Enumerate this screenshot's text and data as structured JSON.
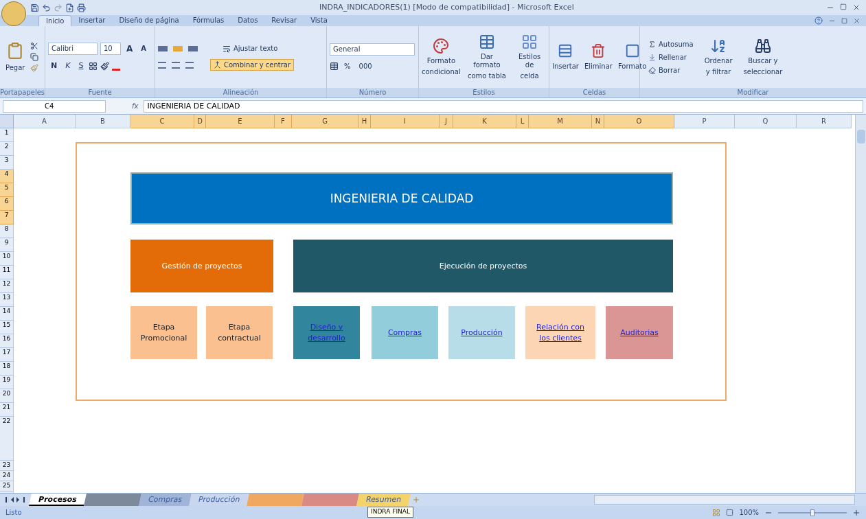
{
  "window": {
    "title": "INDRA_INDICADORES(1)  [Modo de compatibilidad] - Microsoft Excel"
  },
  "ribbon_tabs": [
    {
      "label": "Inicio",
      "selected": true
    },
    {
      "label": "Insertar",
      "selected": false
    },
    {
      "label": "Diseño de página",
      "selected": false
    },
    {
      "label": "Fórmulas",
      "selected": false
    },
    {
      "label": "Datos",
      "selected": false
    },
    {
      "label": "Revisar",
      "selected": false
    },
    {
      "label": "Vista",
      "selected": false
    }
  ],
  "ribbon": {
    "clipboard": {
      "paste": "Pegar",
      "group": "Portapapeles"
    },
    "font": {
      "name": "Calibri",
      "size": "10",
      "grow": "A",
      "shrink": "A",
      "bold": "N",
      "italic": "K",
      "underline": "S",
      "group": "Fuente"
    },
    "alignment": {
      "wrap": "Ajustar texto",
      "merge": "Combinar y centrar",
      "merge_on": true,
      "center_on": true,
      "group": "Alineación"
    },
    "number": {
      "format": "General",
      "percent": "%",
      "thousands": "000",
      "group": "Número"
    },
    "styles": {
      "buttons": [
        [
          "Formato",
          "condicional"
        ],
        [
          "Dar formato",
          "como tabla"
        ],
        [
          "Estilos de",
          "celda"
        ]
      ],
      "group": "Estilos"
    },
    "cells": {
      "buttons": [
        "Insertar",
        "Eliminar",
        "Formato"
      ],
      "group": "Celdas"
    },
    "editing": {
      "small": [
        "Autosuma",
        "Rellenar",
        "Borrar"
      ],
      "buttons": [
        [
          "Ordenar",
          "y filtrar"
        ],
        [
          "Buscar y",
          "seleccionar"
        ]
      ],
      "group": "Modificar"
    }
  },
  "formula_bar": {
    "cell": "C4",
    "fx": "fx",
    "value": "INGENIERIA DE CALIDAD"
  },
  "columns": [
    {
      "label": "A",
      "selected": false
    },
    {
      "label": "B",
      "selected": false
    },
    {
      "label": "C",
      "selected": true
    },
    {
      "label": "D",
      "selected": true
    },
    {
      "label": "E",
      "selected": true
    },
    {
      "label": "F",
      "selected": true
    },
    {
      "label": "G",
      "selected": true
    },
    {
      "label": "H",
      "selected": true
    },
    {
      "label": "I",
      "selected": true
    },
    {
      "label": "J",
      "selected": true
    },
    {
      "label": "K",
      "selected": true
    },
    {
      "label": "L",
      "selected": true
    },
    {
      "label": "M",
      "selected": true
    },
    {
      "label": "N",
      "selected": true
    },
    {
      "label": "O",
      "selected": true
    },
    {
      "label": "P",
      "selected": false
    },
    {
      "label": "Q",
      "selected": false
    },
    {
      "label": "R",
      "selected": false
    }
  ],
  "rows": [
    {
      "label": "1",
      "selected": false
    },
    {
      "label": "2",
      "selected": false
    },
    {
      "label": "3",
      "selected": false
    },
    {
      "label": "4",
      "selected": true
    },
    {
      "label": "5",
      "selected": true
    },
    {
      "label": "6",
      "selected": true
    },
    {
      "label": "7",
      "selected": true
    },
    {
      "label": "8",
      "selected": false
    },
    {
      "label": "9",
      "selected": false
    },
    {
      "label": "10",
      "selected": false
    },
    {
      "label": "11",
      "selected": false
    },
    {
      "label": "12",
      "selected": false
    },
    {
      "label": "13",
      "selected": false
    },
    {
      "label": "14",
      "selected": false
    },
    {
      "label": "15",
      "selected": false
    },
    {
      "label": "16",
      "selected": false
    },
    {
      "label": "17",
      "selected": false
    },
    {
      "label": "18",
      "selected": false
    },
    {
      "label": "19",
      "selected": false
    },
    {
      "label": "20",
      "selected": false
    },
    {
      "label": "21",
      "selected": false
    },
    {
      "label": "22",
      "selected": false
    },
    {
      "label": "23",
      "selected": false
    },
    {
      "label": "24",
      "selected": false
    },
    {
      "label": "25",
      "selected": false
    }
  ],
  "diagram": {
    "shapes": [
      {
        "kind": "title",
        "text": "INGENIERIA DE CALIDAD",
        "color": "#0070c0"
      },
      {
        "kind": "box",
        "text": "Gestión de proyectos",
        "color": "#e36c09"
      },
      {
        "kind": "box",
        "text": "Ejecución de proyectos",
        "color": "#215868"
      },
      {
        "kind": "box",
        "text": "Etapa Promocional",
        "color": "#fac090"
      },
      {
        "kind": "box",
        "text": "Etapa contractual",
        "color": "#fac090"
      },
      {
        "kind": "link",
        "text": "Diseño y desarrollo",
        "color": "#31859c"
      },
      {
        "kind": "link",
        "text": "Compras",
        "color": "#92cddc"
      },
      {
        "kind": "link",
        "text": "Producción",
        "color": "#b7dee8"
      },
      {
        "kind": "link",
        "text": "Relación con los clientes",
        "color": "#fcd5b4"
      },
      {
        "kind": "link",
        "text": "Auditorias",
        "color": "#d99694"
      }
    ]
  },
  "sheet_tabs": [
    {
      "label": "Procesos",
      "selected": true,
      "color": "#ffffff"
    },
    {
      "selected": false,
      "color": "#7d8a9c"
    },
    {
      "label": "Compras",
      "selected": false,
      "color": "#9fb4d6"
    },
    {
      "label": "Producción",
      "selected": false,
      "color": "#c8d7ee"
    },
    {
      "selected": false,
      "color": "#f0a860"
    },
    {
      "selected": false,
      "color": "#d98a84"
    },
    {
      "label": "Resumen",
      "selected": false,
      "color": "#f5d36b"
    }
  ],
  "status_bar": {
    "status": "Listo",
    "tooltip": "INDRA FINAL",
    "zoom": "100%",
    "zoom_slider": {
      "level": 0.5
    }
  }
}
